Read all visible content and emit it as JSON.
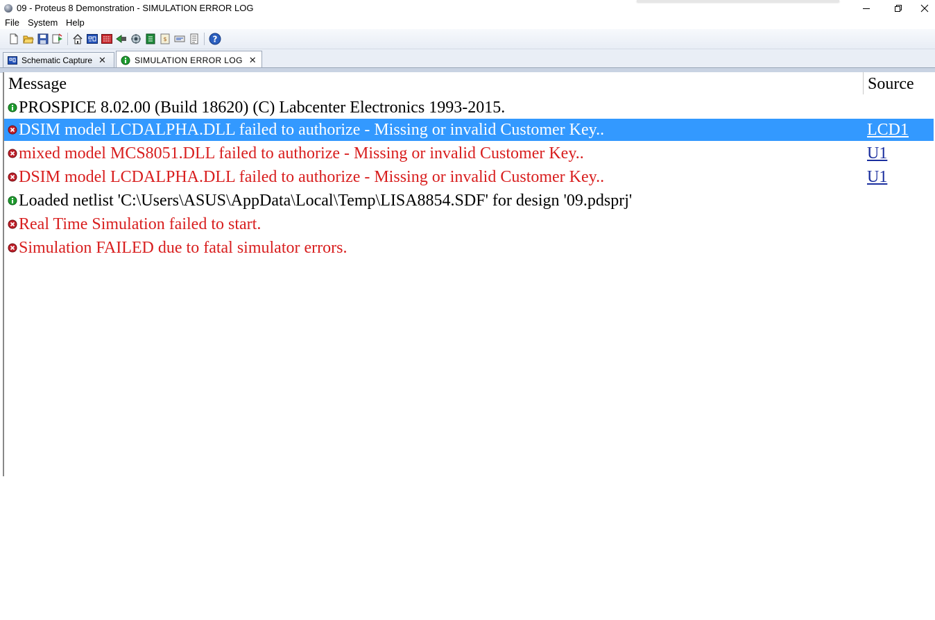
{
  "window": {
    "title": "09 - Proteus 8 Demonstration - SIMULATION ERROR LOG",
    "minimize_icon": "minimize-icon",
    "restore_icon": "restore-icon",
    "close_icon": "close-icon"
  },
  "menu": {
    "items": [
      "File",
      "System",
      "Help"
    ]
  },
  "toolbar": {
    "icons": [
      "new-file-icon",
      "open-folder-icon",
      "save-icon",
      "import-icon",
      "home-icon",
      "schematic-capture-icon",
      "pcb-layout-icon",
      "3d-visualizer-icon",
      "gerber-viewer-icon",
      "design-explorer-icon",
      "bill-of-materials-icon",
      "source-code-icon",
      "notes-icon",
      "help-icon"
    ]
  },
  "tabs": [
    {
      "label": "Schematic Capture",
      "close": "✕",
      "active": false,
      "icon": "schematic-icon"
    },
    {
      "label": "SIMULATION ERROR LOG",
      "close": "✕",
      "active": true,
      "icon": "info-icon"
    }
  ],
  "log": {
    "headers": {
      "message": "Message",
      "source": "Source"
    },
    "rows": [
      {
        "type": "info",
        "message": "PROSPICE 8.02.00 (Build 18620) (C) Labcenter Electronics 1993-2015.",
        "source": "",
        "selected": false
      },
      {
        "type": "error",
        "message": "DSIM model LCDALPHA.DLL failed to authorize - Missing or invalid Customer Key..",
        "source": "LCD1",
        "selected": true
      },
      {
        "type": "error",
        "message": "mixed model MCS8051.DLL failed to authorize - Missing or invalid Customer Key..",
        "source": "U1",
        "selected": false
      },
      {
        "type": "error",
        "message": "DSIM model LCDALPHA.DLL failed to authorize - Missing or invalid Customer Key..",
        "source": "U1",
        "selected": false
      },
      {
        "type": "info",
        "message": "Loaded netlist 'C:\\Users\\ASUS\\AppData\\Local\\Temp\\LISA8854.SDF' for design '09.pdsprj'",
        "source": "",
        "selected": false
      },
      {
        "type": "error",
        "message": "Real Time Simulation failed to start.",
        "source": "",
        "selected": false
      },
      {
        "type": "error",
        "message": "Simulation FAILED due to fatal simulator errors.",
        "source": "",
        "selected": false
      }
    ]
  },
  "colors": {
    "selection": "#3399ff",
    "error_text": "#d81e1e",
    "info_icon": "#1e9b2e",
    "error_icon": "#c0202a",
    "link": "#1a2e9e"
  }
}
